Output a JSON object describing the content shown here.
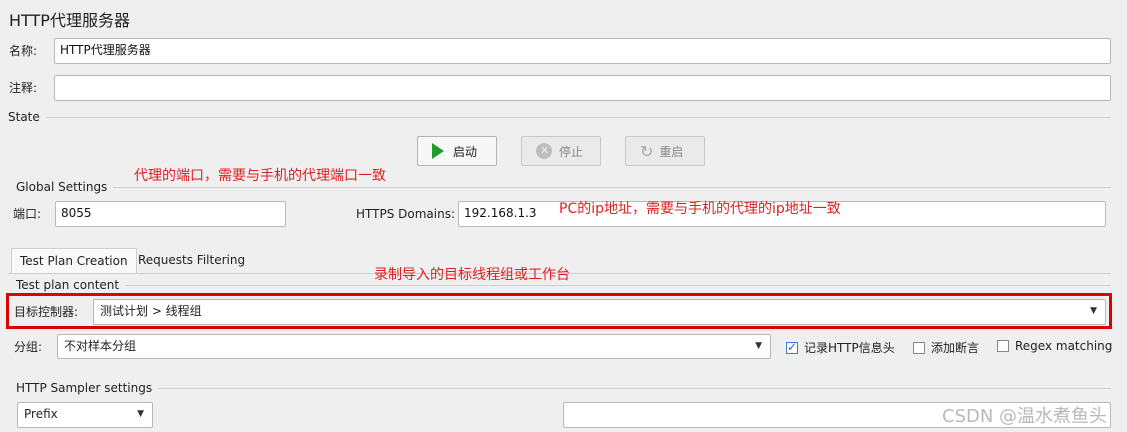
{
  "page": {
    "title": "HTTP代理服务器",
    "name_label": "名称:",
    "name_value": "HTTP代理服务器",
    "comment_label": "注释:",
    "comment_value": ""
  },
  "state": {
    "heading": "State",
    "start_label": "启动",
    "stop_label": "停止",
    "restart_label": "重启"
  },
  "global": {
    "heading": "Global Settings",
    "port_label": "端口:",
    "port_value": "8055",
    "https_label": "HTTPS Domains:",
    "https_value": "192.168.1.3"
  },
  "notes": {
    "port_note": "代理的端口，需要与手机的代理端口一致",
    "ip_note": "PC的ip地址，需要与手机的代理的ip地址一致",
    "target_note": "录制导入的目标线程组或工作台"
  },
  "tabs": [
    {
      "label": "Test Plan Creation",
      "active": true
    },
    {
      "label": "Requests Filtering",
      "active": false
    }
  ],
  "content": {
    "heading": "Test plan content",
    "target_label": "目标控制器:",
    "target_value": "测试计划 > 线程组",
    "group_label": "分组:",
    "group_value": "不对样本分组",
    "record_headers_label": "记录HTTP信息头",
    "record_headers_checked": true,
    "add_assert_label": "添加断言",
    "add_assert_checked": false,
    "regex_label": "Regex matching",
    "regex_checked": false
  },
  "sampler": {
    "heading": "HTTP Sampler settings",
    "prefix_value": "Prefix",
    "prefix_text": ""
  },
  "watermark": "CSDN @温水煮鱼头",
  "colors": {
    "accent_red": "#e00000",
    "start_green": "#1f9d2a"
  }
}
